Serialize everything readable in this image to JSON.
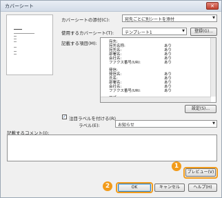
{
  "window": {
    "title": "カバーシート",
    "close_label": "✕"
  },
  "cover_type": {
    "label": "カバーシートの添付(C):",
    "value": "宛先ごとに別シートを添付"
  },
  "template": {
    "label": "使用するカバーシート(T):",
    "value": "テンプレート1",
    "register_button": "登録(G)..."
  },
  "items": {
    "label": "記載する項目(M):",
    "rows": [
      {
        "k": "宛先:",
        "v": ""
      },
      {
        "k": "宛先名称:",
        "v": "あり"
      },
      {
        "k": "宛先名:",
        "v": "あり"
      },
      {
        "k": "部署名:",
        "v": "あり"
      },
      {
        "k": "会社名:",
        "v": "あり"
      },
      {
        "k": "ファクス番号/URI:",
        "v": "あり"
      },
      {
        "k": "発信:",
        "v": ""
      },
      {
        "k": "発信名:",
        "v": "あり"
      },
      {
        "k": "氏名:",
        "v": "あり"
      },
      {
        "k": "部署名:",
        "v": "あり"
      },
      {
        "k": "会社名:",
        "v": "あり"
      },
      {
        "k": "ファクス番号/URI:",
        "v": "あり"
      },
      {
        "k": "ロゴ",
        "v": ""
      }
    ],
    "settings_button": "設定(S)..."
  },
  "attention": {
    "checkbox_label": "注目ラベルを付ける(R)",
    "checked": true,
    "label_label": "ラベル(E):",
    "label_value": "お知らせ"
  },
  "comment": {
    "label": "記載するコメント(I):"
  },
  "buttons": {
    "preview": "プレビュー(V)",
    "ok": "OK",
    "cancel": "キャンセル",
    "help": "ヘルプ(H)"
  },
  "callouts": {
    "one": "1",
    "two": "2"
  },
  "colors": {
    "callout": "#f29b1a",
    "focus": "#3c7fb1"
  }
}
